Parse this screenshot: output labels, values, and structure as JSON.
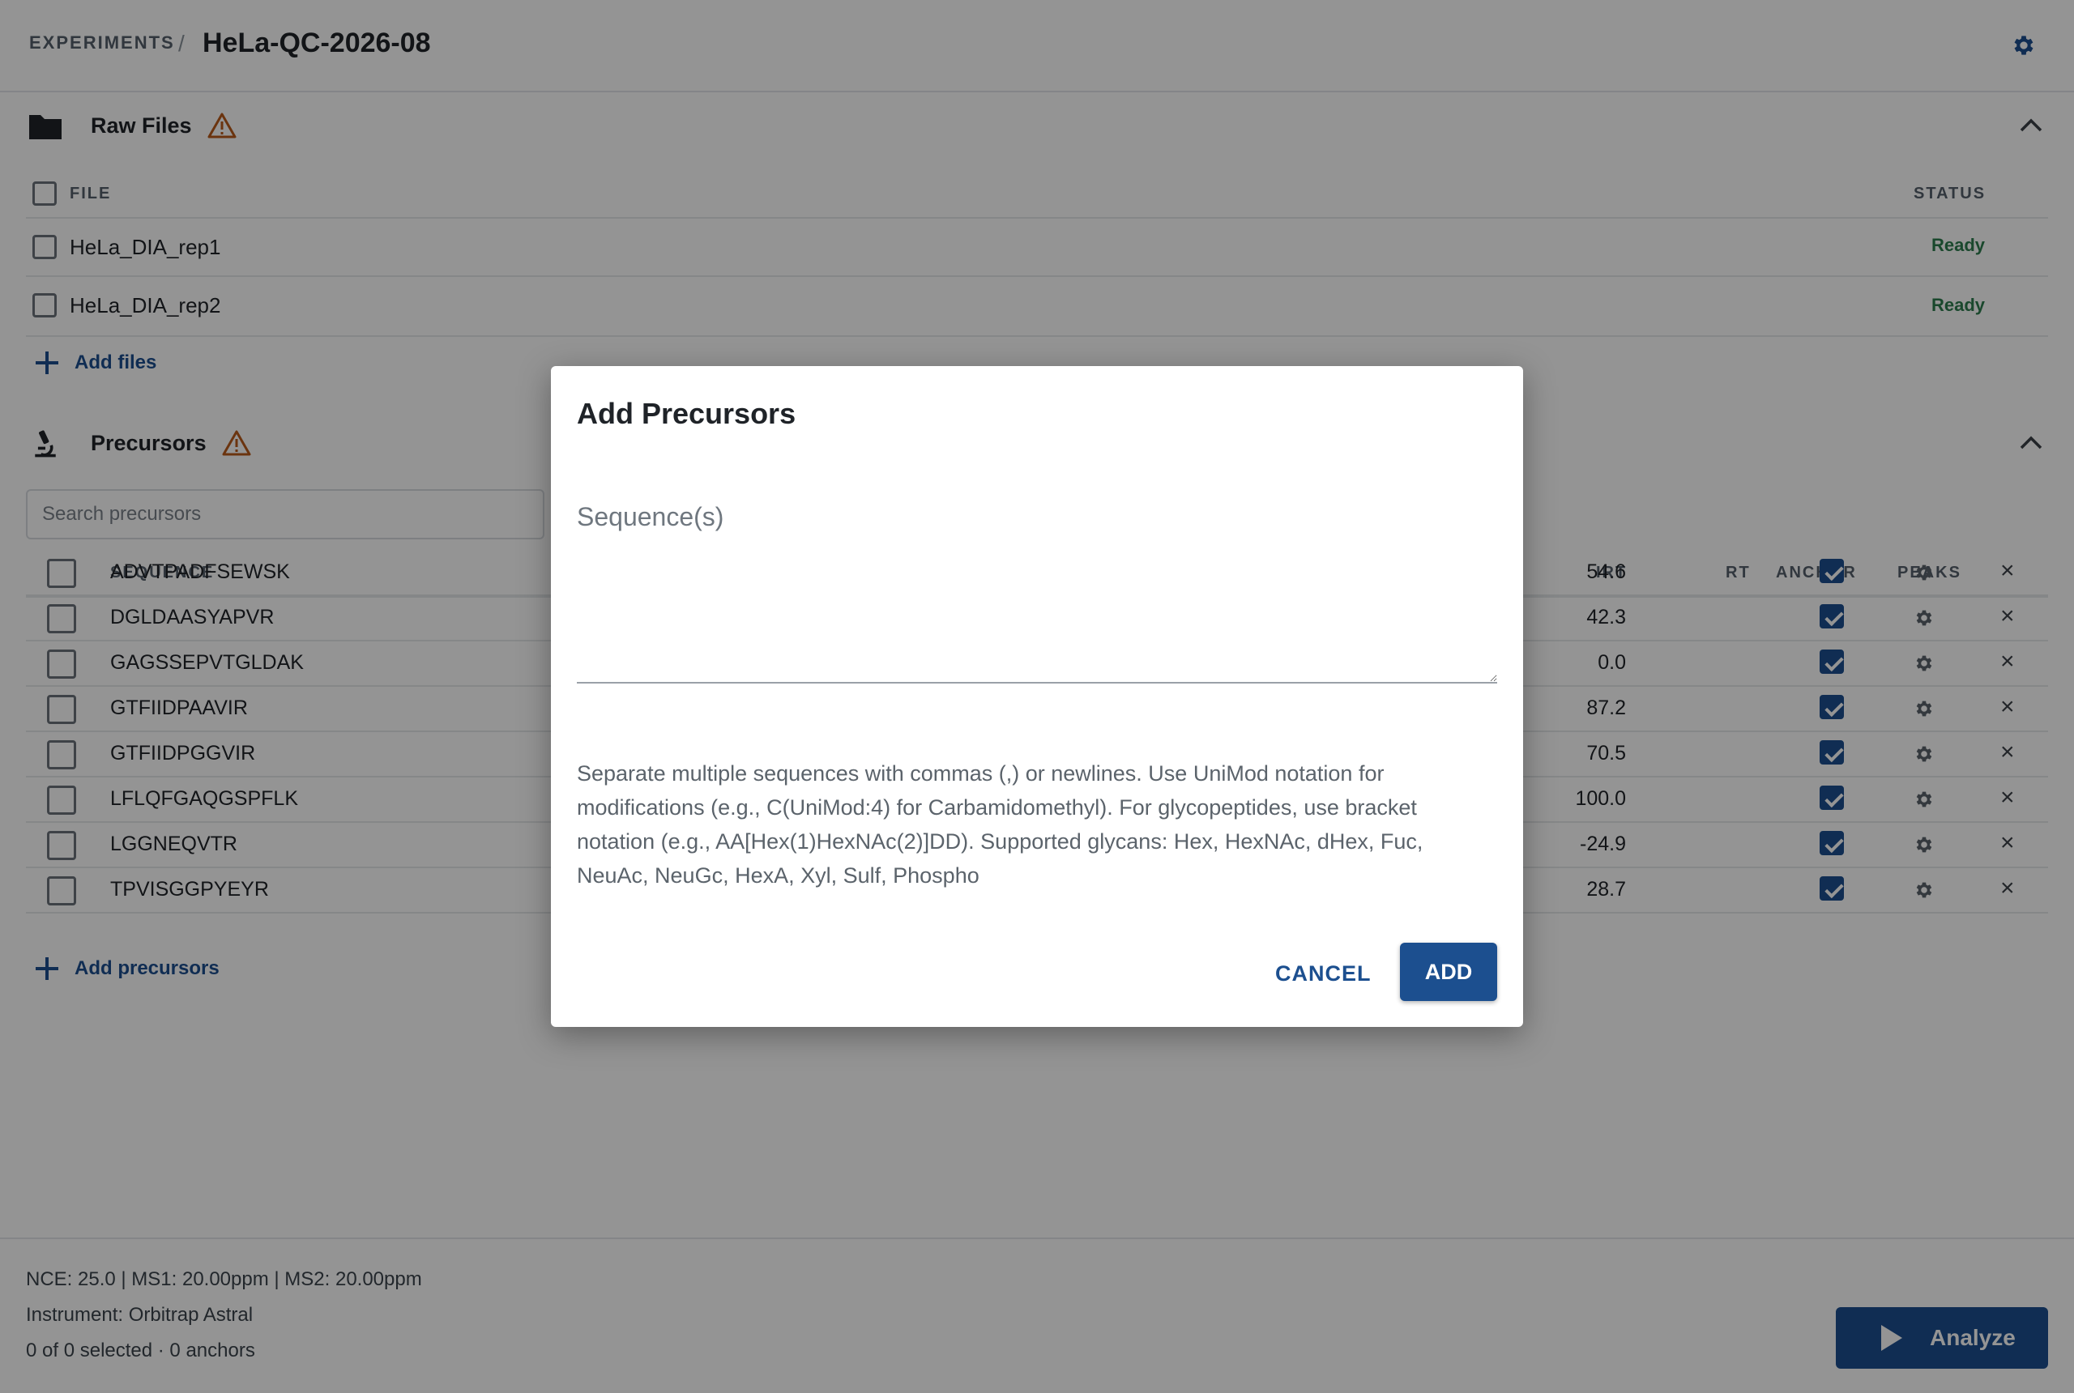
{
  "header": {
    "breadcrumb_root": "EXPERIMENTS",
    "separator": "/",
    "title": "HeLa-QC-2026-08"
  },
  "raw_files": {
    "title": "Raw Files",
    "col_file": "FILE",
    "col_status": "STATUS",
    "files": [
      {
        "name": "HeLa_DIA_rep1",
        "status": "Ready"
      },
      {
        "name": "HeLa_DIA_rep2",
        "status": "Ready"
      }
    ],
    "add_label": "Add files"
  },
  "precursors": {
    "title": "Precursors",
    "search_placeholder": "Search precursors",
    "columns": {
      "sequence": "SEQUENCE",
      "irt": "IRT",
      "rt": "RT",
      "anchor": "ANCHOR",
      "peaks": "PEAKS"
    },
    "rows": [
      {
        "sequence": "ADVTPADFSEWSK",
        "irt": "54.6",
        "anchor": true
      },
      {
        "sequence": "DGLDAASYAPVR",
        "irt": "42.3",
        "anchor": true
      },
      {
        "sequence": "GAGSSEPVTGLDAK",
        "irt": "0.0",
        "anchor": true
      },
      {
        "sequence": "GTFIIDPAAVIR",
        "irt": "87.2",
        "anchor": true
      },
      {
        "sequence": "GTFIIDPGGVIR",
        "irt": "70.5",
        "anchor": true
      },
      {
        "sequence": "LFLQFGAQGSPFLK",
        "irt": "100.0",
        "anchor": true
      },
      {
        "sequence": "LGGNEQVTR",
        "irt": "-24.9",
        "anchor": true
      },
      {
        "sequence": "TPVISGGPYEYR",
        "irt": "28.7",
        "anchor": true
      }
    ],
    "add_label": "Add precursors"
  },
  "footer": {
    "params": "NCE: 25.0 | MS1: 20.00ppm | MS2: 20.00ppm",
    "instrument": "Instrument: Orbitrap Astral",
    "selection": "0 of 0 selected · 0 anchors",
    "analyze_label": "Analyze"
  },
  "dialog": {
    "title": "Add Precursors",
    "field_label": "Sequence(s)",
    "field_value": "",
    "help_text": "Separate multiple sequences with commas (,) or newlines. Use UniMod notation for modifications (e.g., C(UniMod:4) for Carbamidomethyl). For glycopeptides, use bracket notation (e.g., AA[Hex(1)HexNAc(2)]DD). Supported glycans: Hex, HexNAc, dHex, Fuc, NeuAc, NeuGc, HexA, Xyl, Sulf, Phospho",
    "cancel_label": "CANCEL",
    "add_label": "ADD"
  },
  "colors": {
    "accent": "#1c4f8f",
    "ready": "#2e7d4f",
    "warning": "#b85a1a"
  },
  "icons": [
    "gear-icon",
    "folder-icon",
    "warning-icon",
    "chevron-up-icon",
    "microscope-icon",
    "plus-icon",
    "settings-cog-icon",
    "close-icon",
    "play-icon"
  ]
}
